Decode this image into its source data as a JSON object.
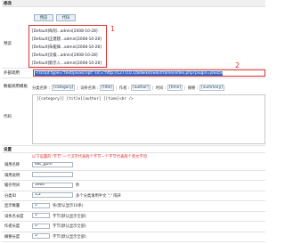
{
  "header": {
    "title": "修改"
  },
  "preview": {
    "label": "预览",
    "tabs": [
      "预览",
      "代码"
    ],
    "items": [
      "[Default]每刻...admin[2008-10-28]",
      "[Default]正建建...admin[2008-10-28]",
      "[Default]朱能锋...admin[2008-10-28]",
      "[Default]交级...admin[2008-10-28]",
      "[Default]新示入...admin[2008-10-28]"
    ],
    "callout": "1"
  },
  "external_call": {
    "label": "外部调用",
    "value": "<script type=\"text/javascript\" src=\"http://127.0.0.1/bdwiki4/wiki/frame/index.php?plugin=jswizard-gszq\"></",
    "callout": "2"
  },
  "template": {
    "label": "数据调用模板",
    "toolbar": [
      {
        "text": "分类名称 :",
        "type": "text"
      },
      {
        "text": "[category]",
        "type": "btn"
      },
      {
        "text": "词条名称 :",
        "type": "text"
      },
      {
        "text": "[title]",
        "type": "btn"
      },
      {
        "text": "作者 :",
        "type": "text"
      },
      {
        "text": "[author]",
        "type": "btn"
      },
      {
        "text": "时间 :",
        "type": "text"
      },
      {
        "text": "[time]",
        "type": "btn"
      },
      {
        "text": "摘要 :",
        "type": "text"
      },
      {
        "text": "[summary]",
        "type": "btn"
      }
    ]
  },
  "code": {
    "label": "代码",
    "value": "[[category]] [title][author] [[time]<br />"
  },
  "settings": {
    "label": "设置",
    "warning": "以下设置的“字节”一个汉字代表两个字节一个字节代表两个英文字母",
    "fields": [
      {
        "label": "调用名称",
        "value": "doc_g2m",
        "hint": "",
        "width": 46
      },
      {
        "label": "调用说明",
        "value": "",
        "hint": "",
        "width": 46
      },
      {
        "label": "缓存时间",
        "value": "1600",
        "hint": "秒",
        "width": 46
      },
      {
        "label": "分类ID",
        "value": "1,2",
        "hint": "多个分类请用半文 \",\" 隔开",
        "width": 46
      },
      {
        "label": "显示数量",
        "value": "5",
        "hint": "条(默认显示10条)",
        "width": 20
      },
      {
        "label": "词条名长度",
        "value": "5",
        "hint": "字节(默认显示全部)",
        "width": 20
      },
      {
        "label": "作者长度",
        "value": "5",
        "hint": "字节(默认显示全部)",
        "width": 20
      },
      {
        "label": "摘要长度",
        "value": "5",
        "hint": "字节(默认显示全部)",
        "width": 20
      }
    ]
  },
  "colors": {
    "accent": "#e03030",
    "selection": "#2f6bd1",
    "border": "#a8b4c2"
  }
}
